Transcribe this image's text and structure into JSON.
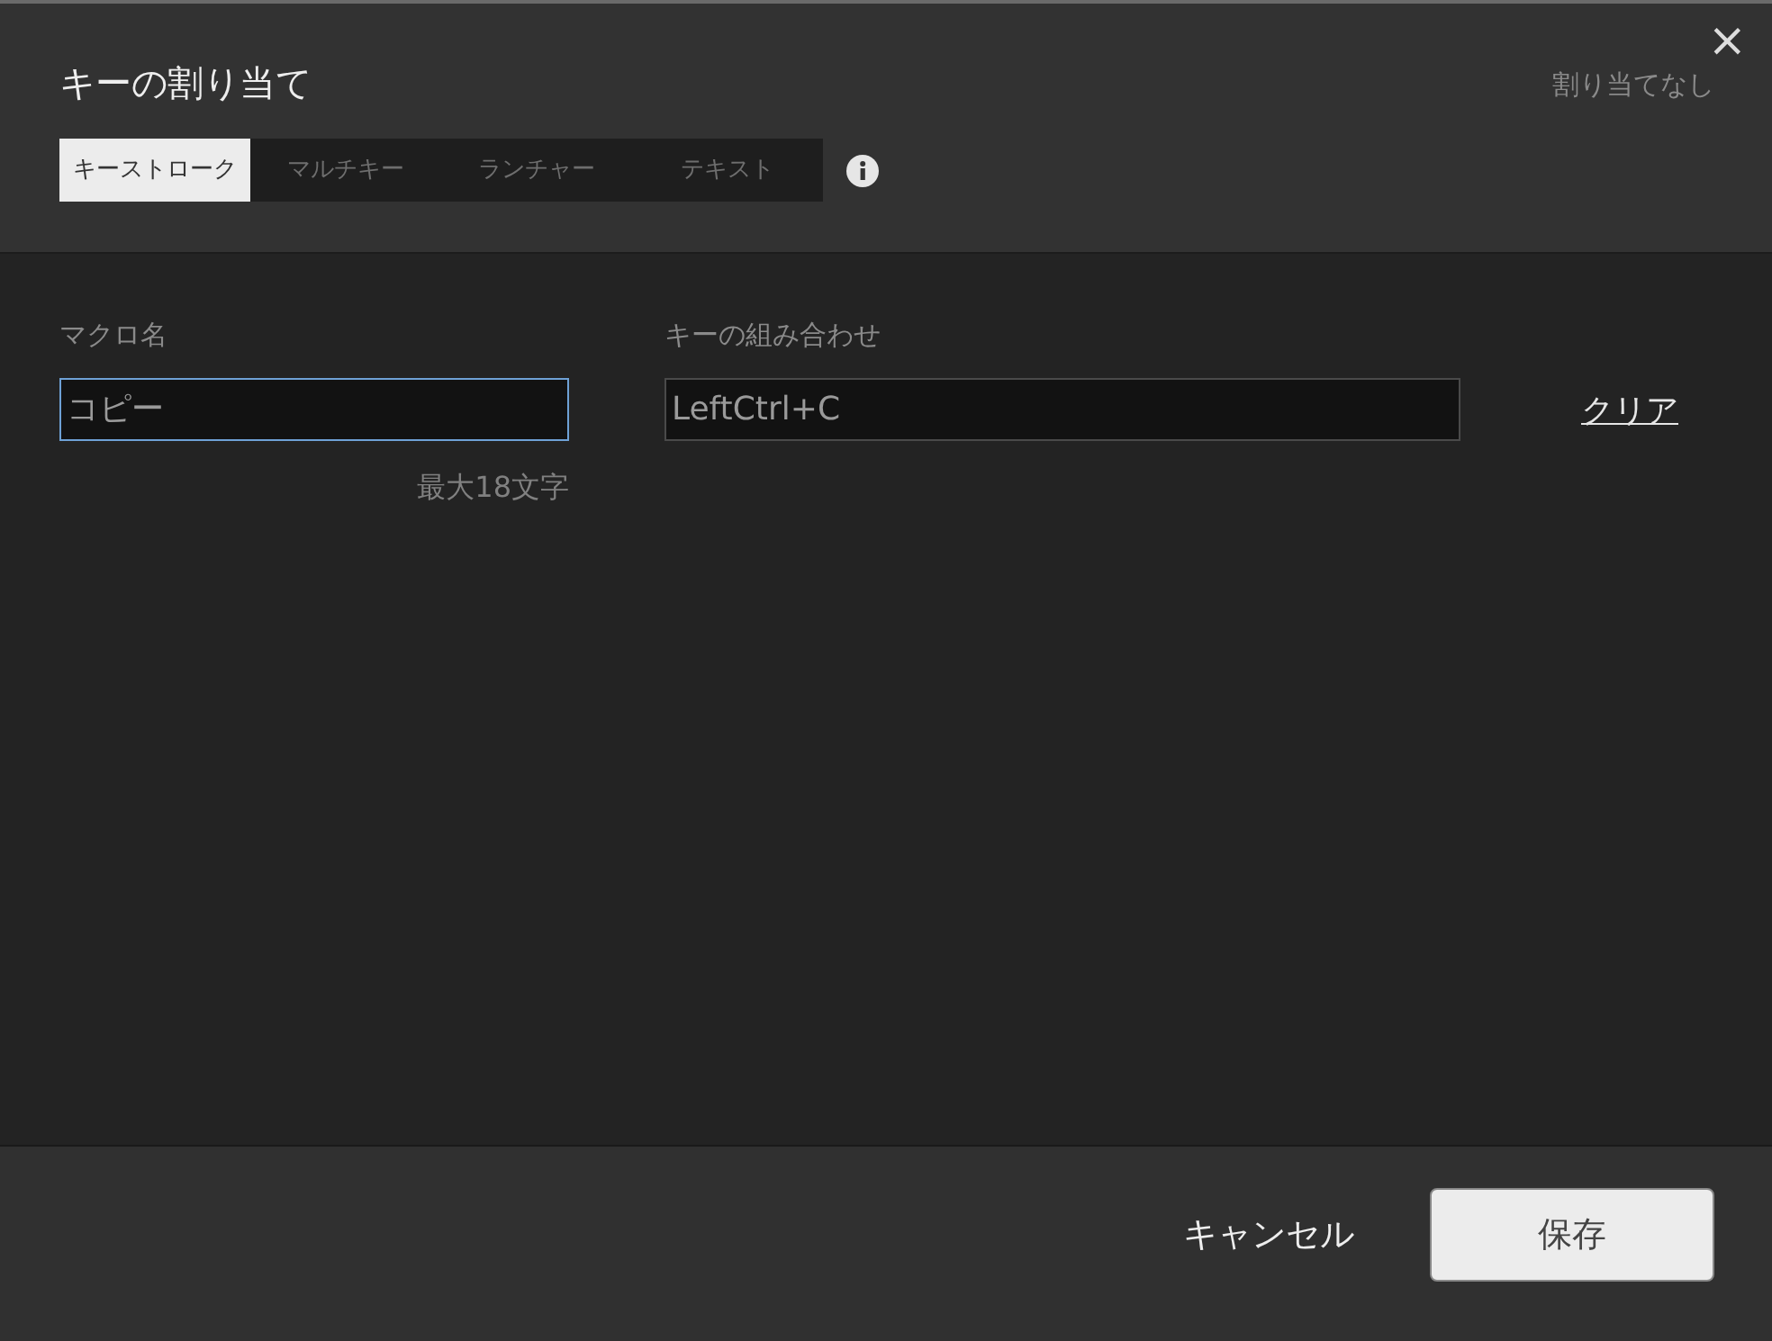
{
  "dialog": {
    "title": "キーの割り当て",
    "status": "割り当てなし",
    "close": "×"
  },
  "tabs": [
    {
      "label": "キーストローク",
      "selected": true
    },
    {
      "label": "マルチキー",
      "selected": false
    },
    {
      "label": "ランチャー",
      "selected": false
    },
    {
      "label": "テキスト",
      "selected": false
    }
  ],
  "macro_name": {
    "label": "マクロ名",
    "value": "コピー",
    "focused": true,
    "hint": "最大18文字"
  },
  "key_combo": {
    "label": "キーの組み合わせ",
    "value": "LeftCtrl+C",
    "focused": false
  },
  "clear_link": "クリア",
  "buttons": [
    {
      "kind": "link",
      "label": "キャンセル"
    },
    {
      "kind": "primary",
      "label": "保存"
    }
  ]
}
